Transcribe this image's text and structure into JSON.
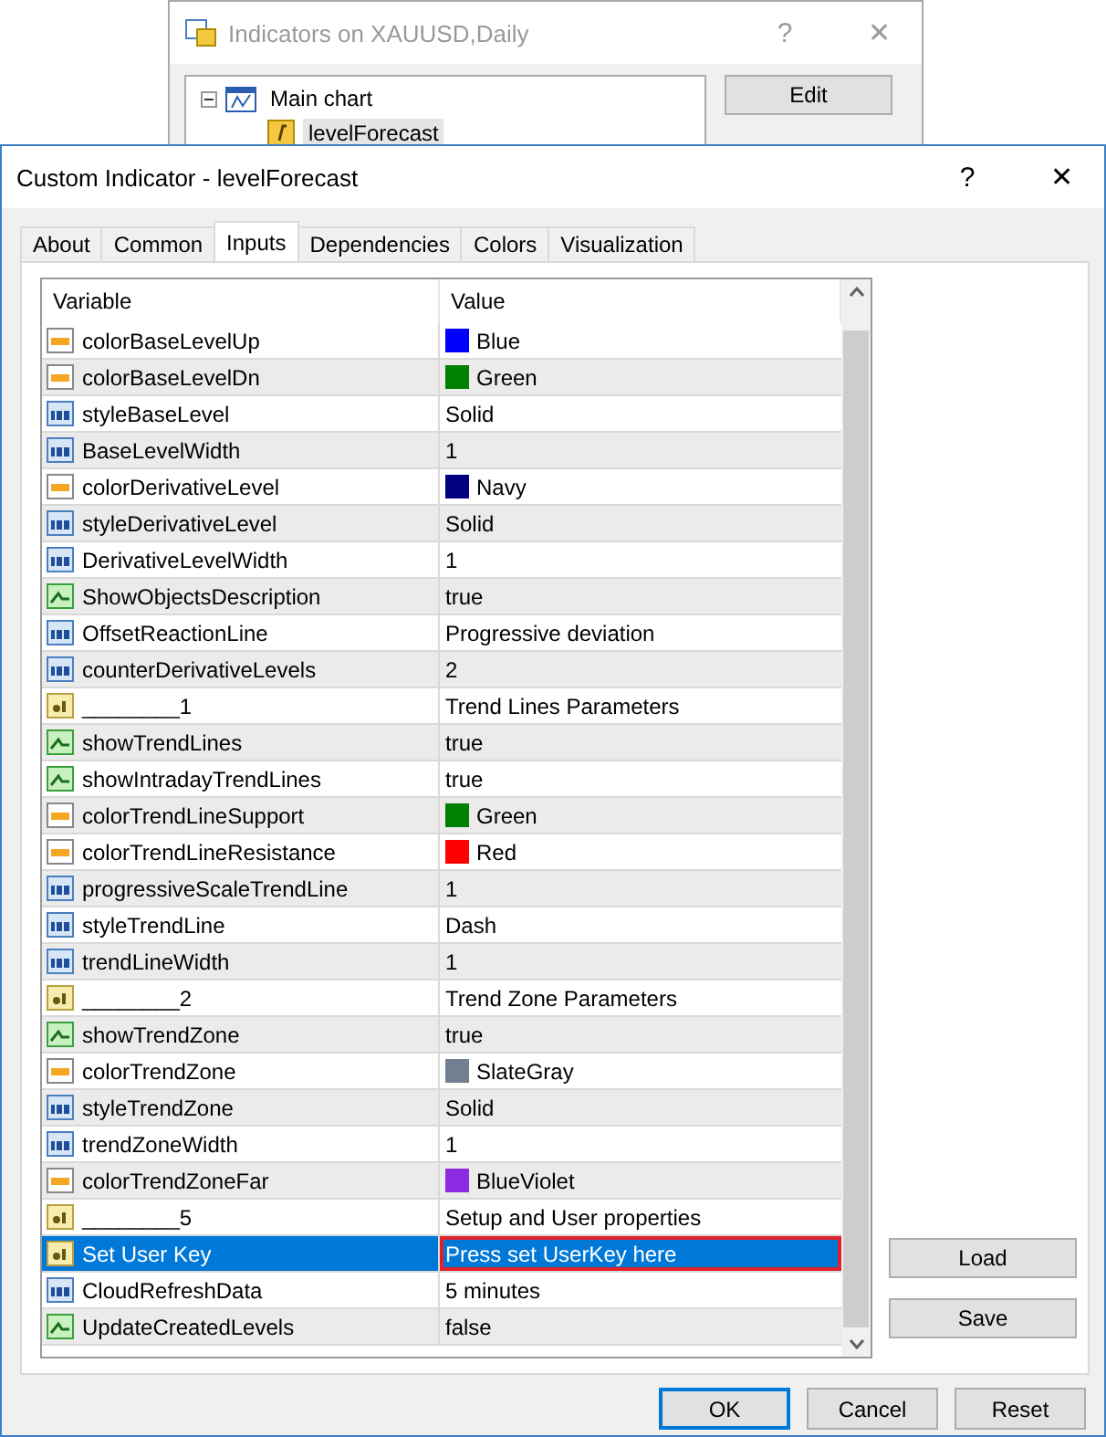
{
  "back_window": {
    "title": "Indicators on XAUUSD,Daily",
    "help": "?",
    "close": "✕",
    "tree": [
      {
        "label": "Main chart",
        "expanded": true,
        "selected": false,
        "children": [
          {
            "label": "levelForecast",
            "selected": true
          }
        ]
      }
    ],
    "buttons": [
      "Edit"
    ]
  },
  "dialog": {
    "title": "Custom Indicator - levelForecast",
    "help": "?",
    "close": "✕",
    "tabs": [
      {
        "label": "About",
        "selected": false
      },
      {
        "label": "Common",
        "selected": false
      },
      {
        "label": "Inputs",
        "selected": true
      },
      {
        "label": "Dependencies",
        "selected": false
      },
      {
        "label": "Colors",
        "selected": false
      },
      {
        "label": "Visualization",
        "selected": false
      }
    ],
    "table": {
      "columns": [
        "Variable",
        "Value"
      ],
      "rows": [
        {
          "kind": "color",
          "name": "colorBaseLevelUp",
          "value": "Blue",
          "color": "#0000ff",
          "selected": false,
          "framed": false
        },
        {
          "kind": "color",
          "name": "colorBaseLevelDn",
          "value": "Green",
          "color": "#008000",
          "selected": false,
          "framed": false
        },
        {
          "kind": "number",
          "name": "styleBaseLevel",
          "value": "Solid",
          "selected": false,
          "framed": false
        },
        {
          "kind": "number",
          "name": "BaseLevelWidth",
          "value": "1",
          "selected": false,
          "framed": false
        },
        {
          "kind": "color",
          "name": "colorDerivativeLevel",
          "value": "Navy",
          "color": "#000080",
          "selected": false,
          "framed": false
        },
        {
          "kind": "number",
          "name": "styleDerivativeLevel",
          "value": "Solid",
          "selected": false,
          "framed": false
        },
        {
          "kind": "number",
          "name": "DerivativeLevelWidth",
          "value": "1",
          "selected": false,
          "framed": false
        },
        {
          "kind": "bool",
          "name": "ShowObjectsDescription",
          "value": "true",
          "selected": false,
          "framed": false
        },
        {
          "kind": "number",
          "name": "OffsetReactionLine",
          "value": "Progressive deviation",
          "selected": false,
          "framed": false
        },
        {
          "kind": "number",
          "name": "counterDerivativeLevels",
          "value": "2",
          "selected": false,
          "framed": false
        },
        {
          "kind": "string",
          "name": "________1",
          "value": "Trend Lines Parameters",
          "selected": false,
          "framed": false
        },
        {
          "kind": "bool",
          "name": "showTrendLines",
          "value": "true",
          "selected": false,
          "framed": false
        },
        {
          "kind": "bool",
          "name": "showIntradayTrendLines",
          "value": "true",
          "selected": false,
          "framed": false
        },
        {
          "kind": "color",
          "name": "colorTrendLineSupport",
          "value": "Green",
          "color": "#008000",
          "selected": false,
          "framed": false
        },
        {
          "kind": "color",
          "name": "colorTrendLineResistance",
          "value": "Red",
          "color": "#ff0000",
          "selected": false,
          "framed": false
        },
        {
          "kind": "number",
          "name": "progressiveScaleTrendLine",
          "value": "1",
          "selected": false,
          "framed": false
        },
        {
          "kind": "number",
          "name": "styleTrendLine",
          "value": "Dash",
          "selected": false,
          "framed": false
        },
        {
          "kind": "number",
          "name": "trendLineWidth",
          "value": "1",
          "selected": false,
          "framed": false
        },
        {
          "kind": "string",
          "name": "________2",
          "value": "Trend Zone Parameters",
          "selected": false,
          "framed": false
        },
        {
          "kind": "bool",
          "name": "showTrendZone",
          "value": "true",
          "selected": false,
          "framed": false
        },
        {
          "kind": "color",
          "name": "colorTrendZone",
          "value": "SlateGray",
          "color": "#708090",
          "selected": false,
          "framed": false
        },
        {
          "kind": "number",
          "name": "styleTrendZone",
          "value": "Solid",
          "selected": false,
          "framed": false
        },
        {
          "kind": "number",
          "name": "trendZoneWidth",
          "value": "1",
          "selected": false,
          "framed": false
        },
        {
          "kind": "color",
          "name": "colorTrendZoneFar",
          "value": "BlueViolet",
          "color": "#8a2be2",
          "selected": false,
          "framed": false
        },
        {
          "kind": "string",
          "name": "________5",
          "value": "Setup and User properties",
          "selected": false,
          "framed": false
        },
        {
          "kind": "string",
          "name": "Set User Key",
          "value": "Press set UserKey here",
          "selected": true,
          "framed": true
        },
        {
          "kind": "number",
          "name": "CloudRefreshData",
          "value": "5 minutes",
          "selected": false,
          "framed": false
        },
        {
          "kind": "bool",
          "name": "UpdateCreatedLevels",
          "value": "false",
          "selected": false,
          "framed": false
        }
      ]
    },
    "side_buttons": [
      "Load",
      "Save"
    ],
    "footer_buttons": [
      {
        "label": "OK",
        "default": true
      },
      {
        "label": "Cancel",
        "default": false
      },
      {
        "label": "Reset",
        "default": false
      }
    ]
  }
}
